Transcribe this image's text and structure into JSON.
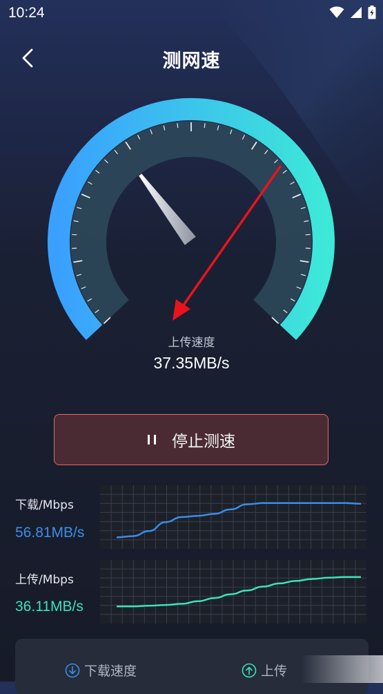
{
  "status_bar": {
    "time": "10:24",
    "icons": [
      "wifi-icon",
      "signal-icon",
      "battery-icon"
    ]
  },
  "header": {
    "title": "测网速",
    "back_icon": "chevron-left-icon"
  },
  "gauge": {
    "label": "上传速度",
    "value": "37.35MB/s",
    "needle_fraction": 0.36,
    "colors": {
      "arc_start": "#3aa0ff",
      "arc_end": "#3de8d8",
      "needle": "#ffffff"
    }
  },
  "stop_button": {
    "label": "停止测速",
    "icon": "pause-icon",
    "border_color": "#e6685d"
  },
  "download": {
    "label": "下载/Mbps",
    "value": "56.81MB/s",
    "color": "#3a8ee8",
    "trend": [
      0.18,
      0.2,
      0.28,
      0.42,
      0.5,
      0.52,
      0.55,
      0.62,
      0.7,
      0.72,
      0.72,
      0.72,
      0.72,
      0.72,
      0.72,
      0.71
    ]
  },
  "upload": {
    "label": "上传/Mbps",
    "value": "36.11MB/s",
    "color": "#3ce3b8",
    "trend": [
      0.27,
      0.27,
      0.28,
      0.29,
      0.31,
      0.35,
      0.4,
      0.46,
      0.52,
      0.58,
      0.63,
      0.67,
      0.7,
      0.72,
      0.73,
      0.73
    ]
  },
  "bottom_tabs": [
    {
      "label": "下载速度",
      "icon": "download-circle-icon"
    },
    {
      "label": "上传",
      "icon": "upload-circle-icon"
    }
  ]
}
